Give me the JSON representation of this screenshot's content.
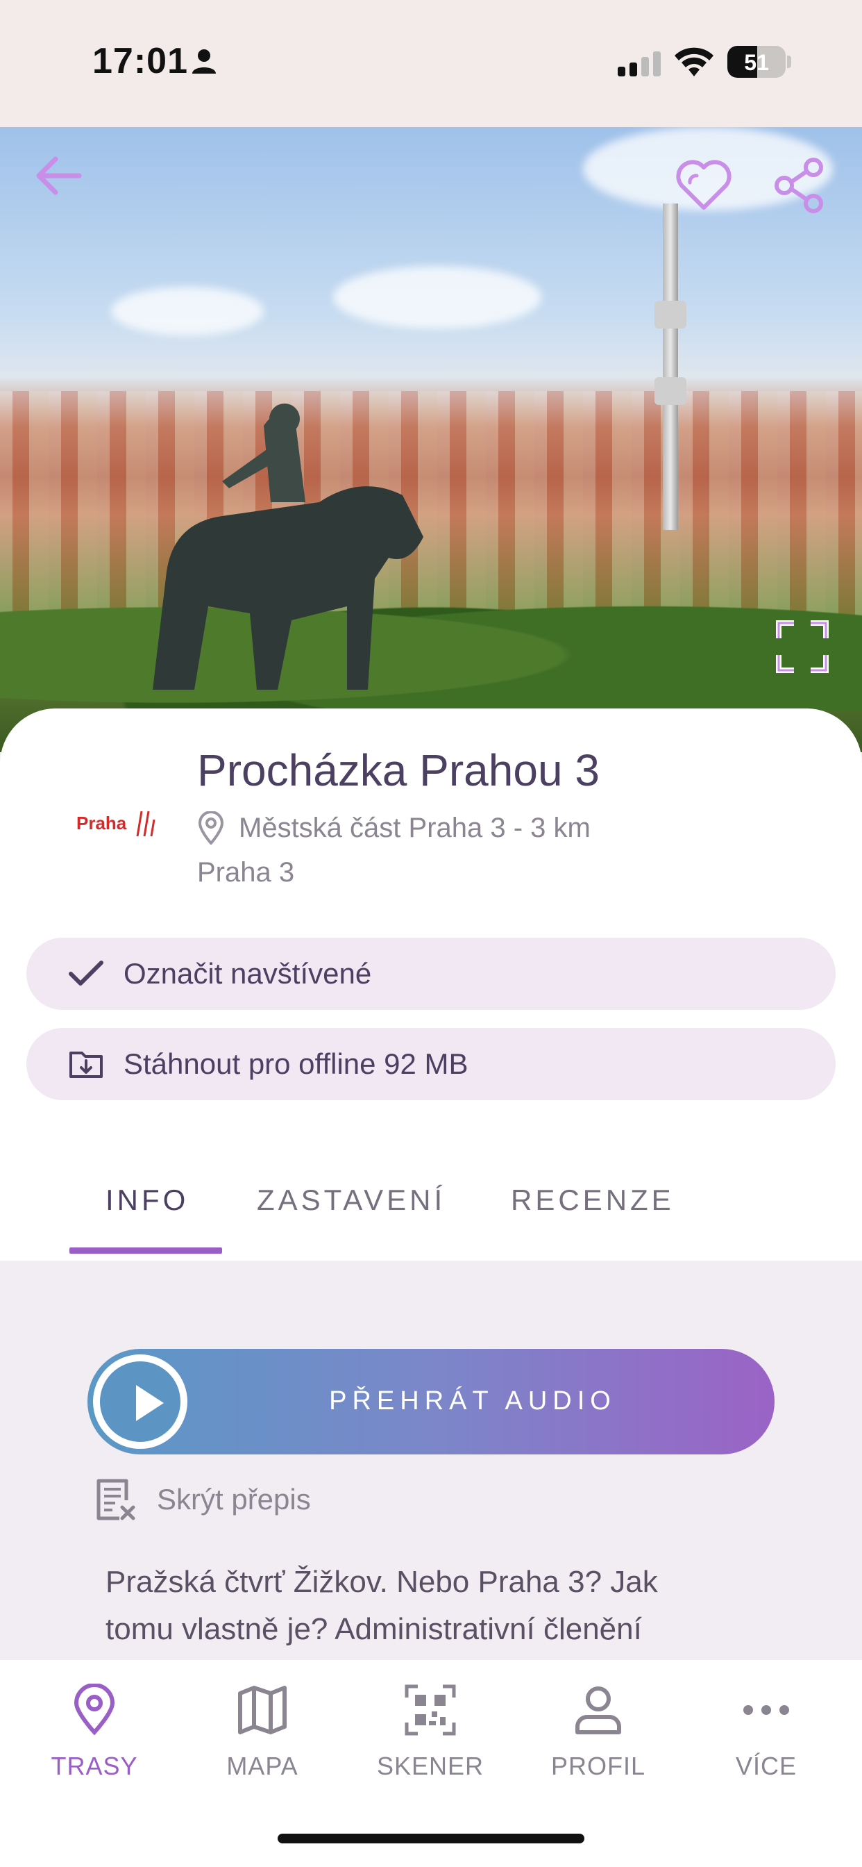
{
  "status_bar": {
    "time": "17:01",
    "battery": "51",
    "battery_level_percent": 51
  },
  "hero": {
    "back_icon": "arrow-left-icon",
    "favorite_icon": "heart-icon",
    "share_icon": "share-icon",
    "expand_icon": "fullscreen-icon"
  },
  "route": {
    "brand_logo_text": "Praha",
    "title": "Procházka Prahou 3",
    "location": "Městská část Praha 3 - 3 km",
    "area": "Praha 3"
  },
  "actions": {
    "mark_visited": "Označit navštívené",
    "download_offline": "Stáhnout pro offline 92 MB"
  },
  "tabs": [
    {
      "label": "INFO",
      "active": true
    },
    {
      "label": "ZASTAVENÍ",
      "active": false
    },
    {
      "label": "RECENZE",
      "active": false
    }
  ],
  "audio": {
    "play_label": "PŘEHRÁT AUDIO",
    "hide_transcript": "Skrýt přepis"
  },
  "description": "Pražská čtvrť Žižkov. Nebo Praha 3? Jak tomu vlastně je? Administrativní členění",
  "bottom_nav": [
    {
      "label": "TRASY",
      "icon": "map-pin-icon",
      "active": true
    },
    {
      "label": "MAPA",
      "icon": "map-icon",
      "active": false
    },
    {
      "label": "SKENER",
      "icon": "qr-scanner-icon",
      "active": false
    },
    {
      "label": "PROFIL",
      "icon": "user-icon",
      "active": false
    },
    {
      "label": "VÍCE",
      "icon": "more-icon",
      "active": false
    }
  ],
  "colors": {
    "accent": "#9a5fc7",
    "title": "#4b3f62",
    "pill_bg": "#f1e8f3",
    "audio_gradient_start": "#5a98c6",
    "audio_gradient_end": "#9b63c6"
  }
}
